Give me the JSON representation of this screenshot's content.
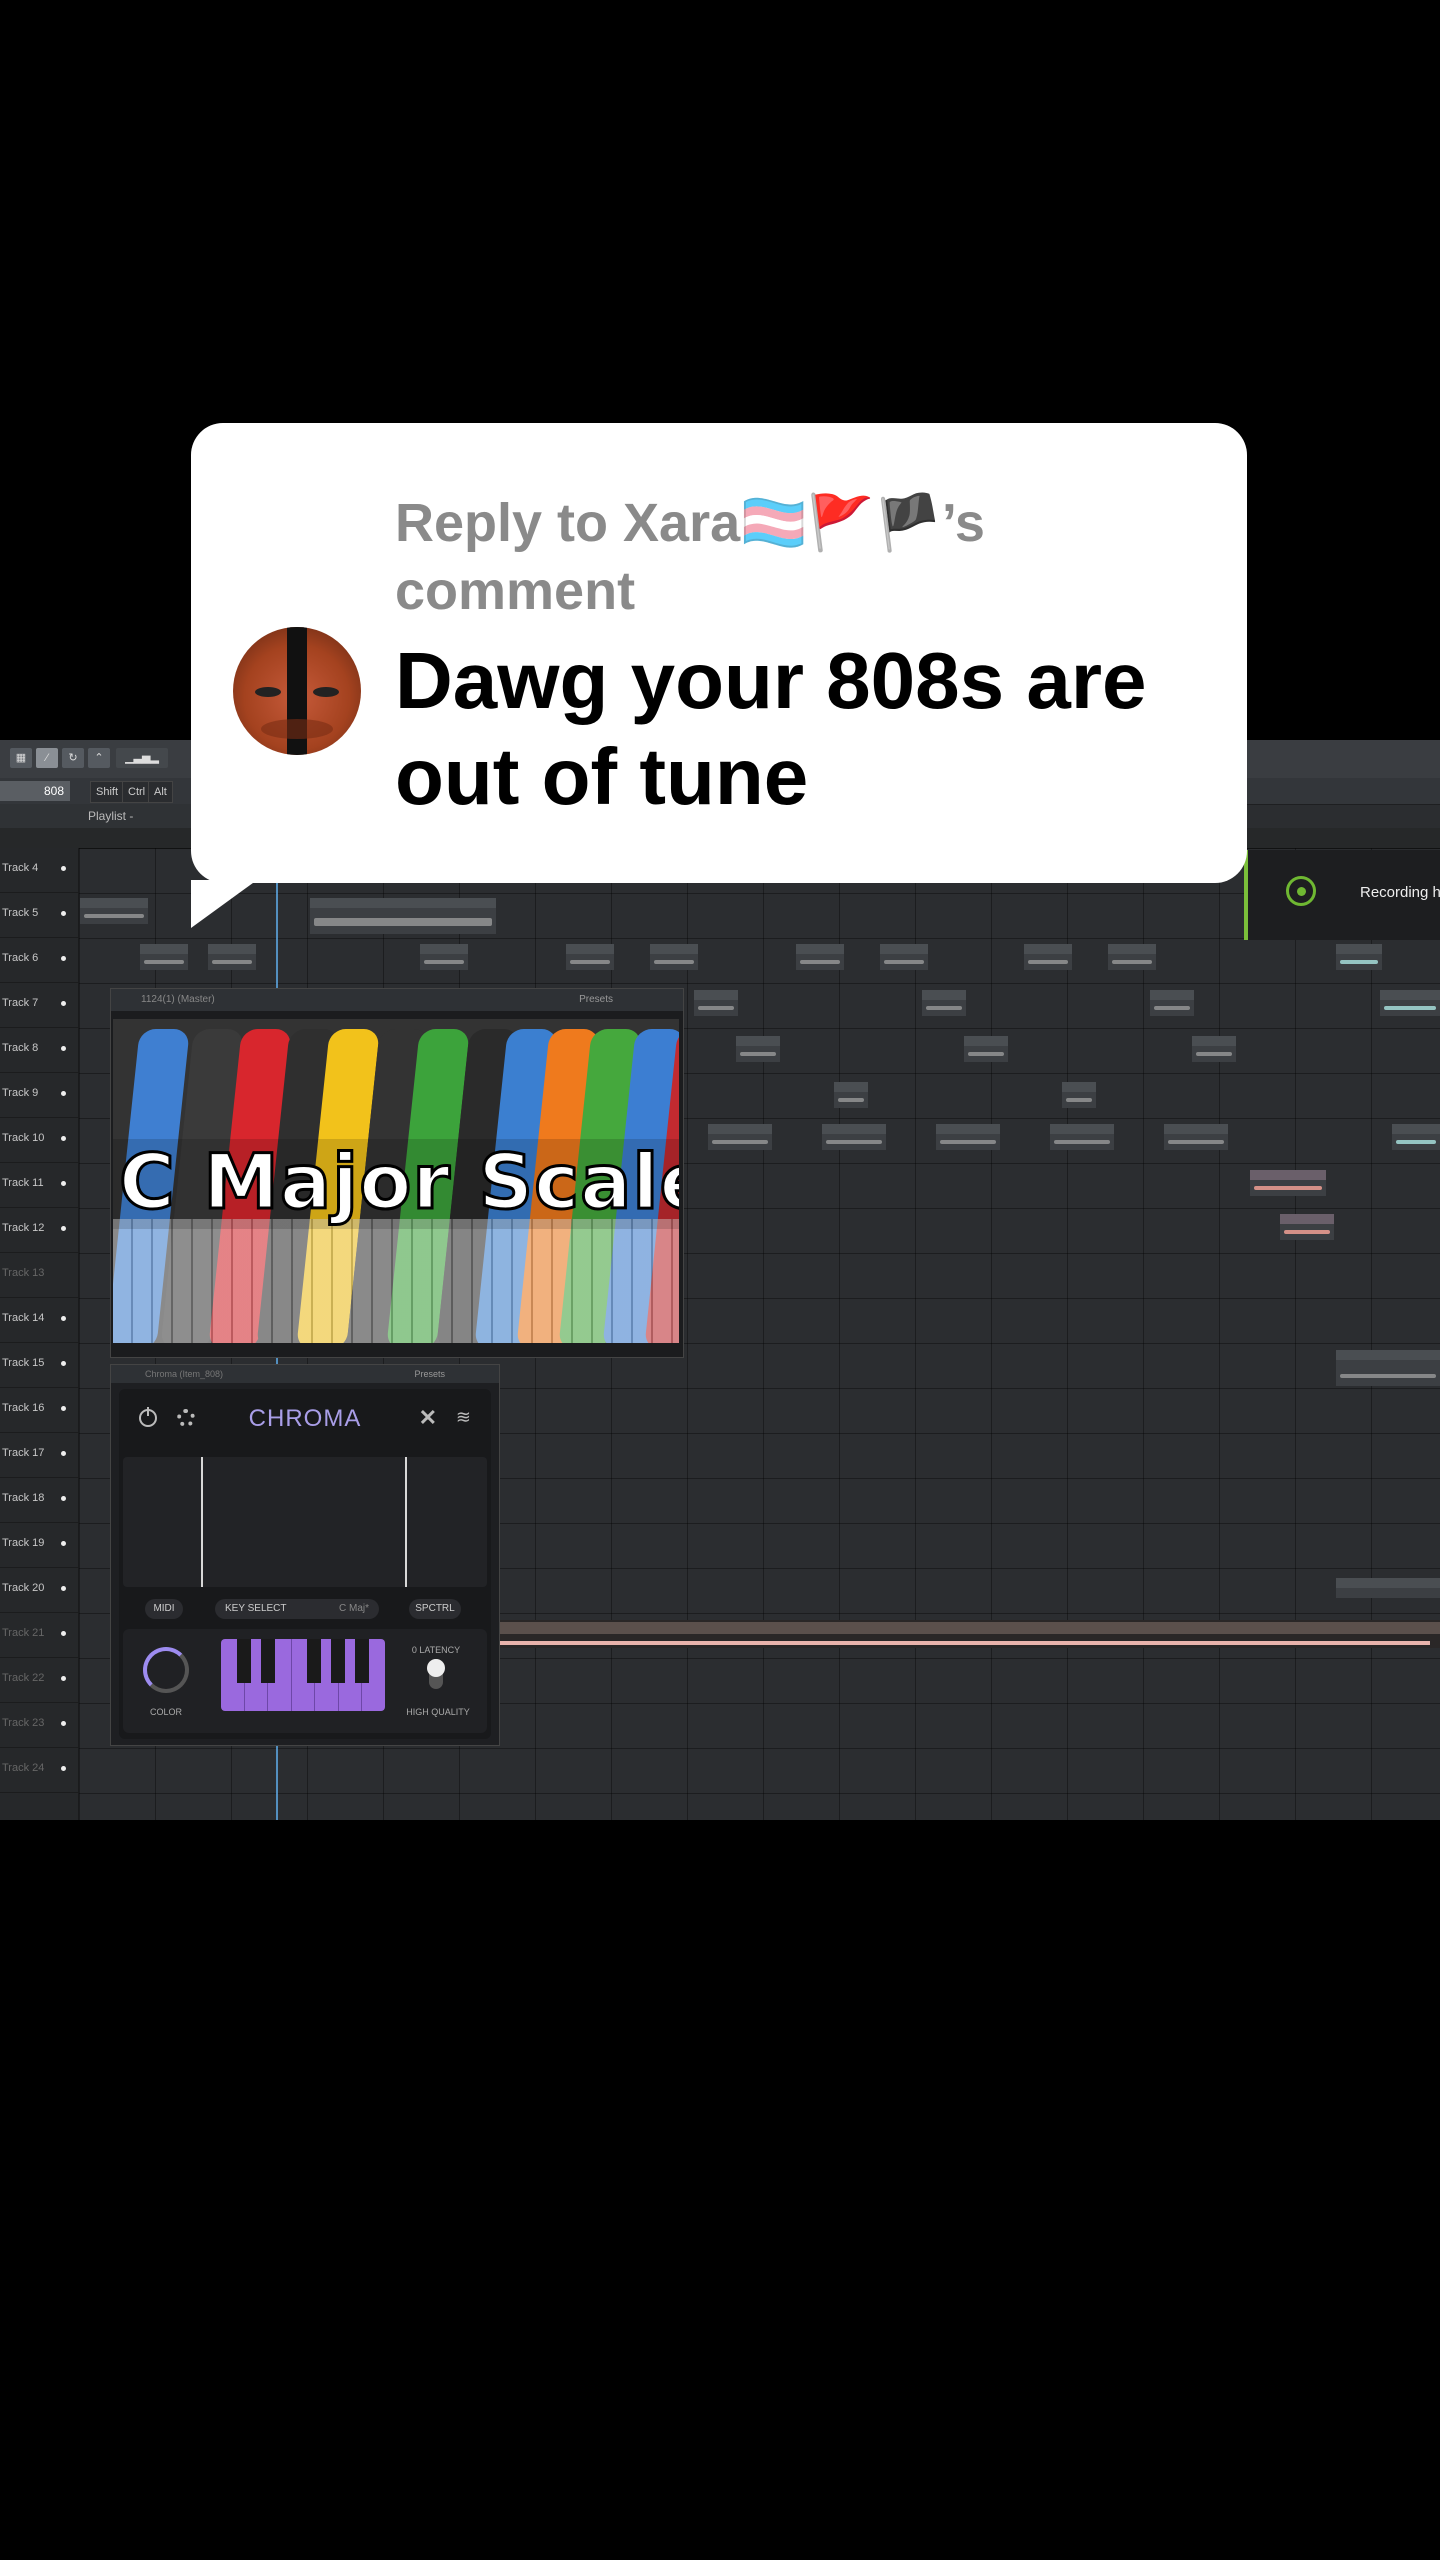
{
  "comment_bubble": {
    "reply_label": "Reply to Xara🏳️‍⚧️🚩🏴’s comment",
    "comment_text": "Dawg your 808s are out of tune"
  },
  "daw": {
    "pattern_name": "808",
    "modifier_keys": [
      "Shift",
      "Ctrl",
      "Alt"
    ],
    "playlist_title": "Playlist - Arrangement",
    "recording_text": "Recording h",
    "tracks": [
      {
        "label": "Track 4",
        "dim": false
      },
      {
        "label": "Track 5",
        "dim": false
      },
      {
        "label": "Track 6",
        "dim": false
      },
      {
        "label": "Track 7",
        "dim": false
      },
      {
        "label": "Track 8",
        "dim": false
      },
      {
        "label": "Track 9",
        "dim": false
      },
      {
        "label": "Track 10",
        "dim": false
      },
      {
        "label": "Track 11",
        "dim": false
      },
      {
        "label": "Track 12",
        "dim": false
      },
      {
        "label": "Track 13",
        "dim": true
      },
      {
        "label": "Track 14",
        "dim": false
      },
      {
        "label": "Track 15",
        "dim": false
      },
      {
        "label": "Track 16",
        "dim": false
      },
      {
        "label": "Track 17",
        "dim": false
      },
      {
        "label": "Track 18",
        "dim": false
      },
      {
        "label": "Track 19",
        "dim": false
      },
      {
        "label": "Track 20",
        "dim": false
      },
      {
        "label": "Track 21",
        "dim": true
      },
      {
        "label": "Track 22",
        "dim": true
      },
      {
        "label": "Track 23",
        "dim": true
      },
      {
        "label": "Track 24",
        "dim": true
      }
    ]
  },
  "video_window": {
    "title": "1124(1) (Master)",
    "presets_label": "Presets",
    "overlay_text": "C Major Scale"
  },
  "chroma": {
    "window_title": "Chroma (Item_808)",
    "presets_label": "Presets",
    "logo": "CHROMA",
    "midi_label": "MIDI",
    "key_select_label": "KEY SELECT",
    "key_value": "C Maj*",
    "spctrl_label": "SPCTRL",
    "color_label": "COLOR",
    "latency_label": "0 LATENCY",
    "quality_label": "HIGH QUALITY"
  }
}
